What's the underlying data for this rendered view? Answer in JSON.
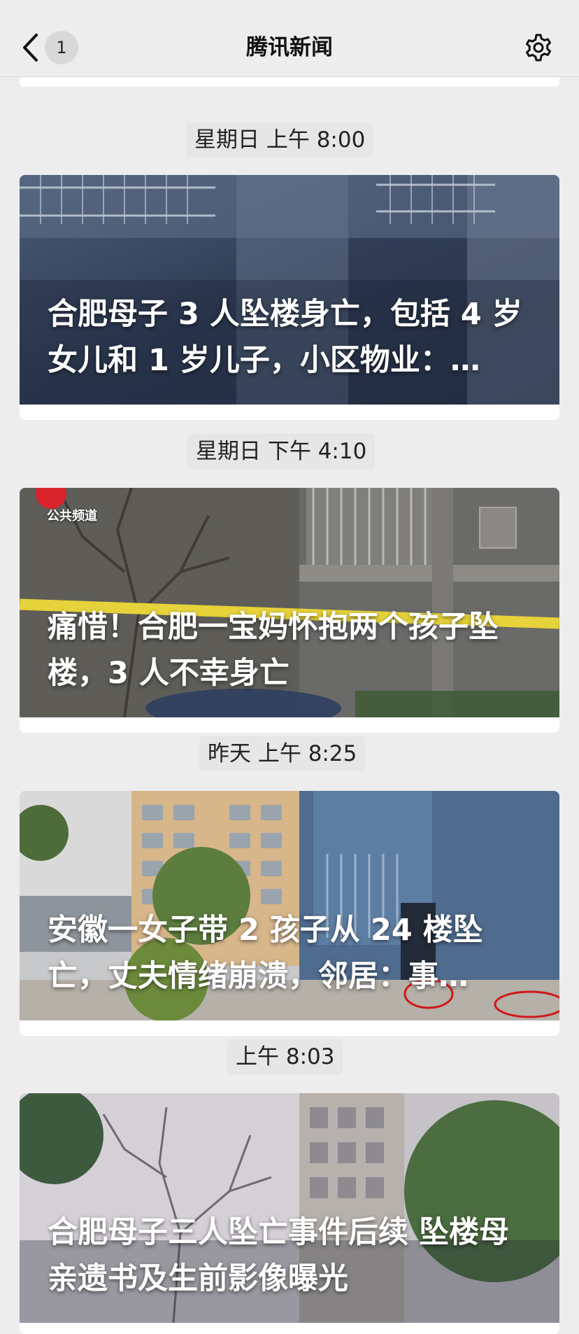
{
  "header": {
    "title": "腾讯新闻",
    "unread_count": "1",
    "back_icon": "chevron-left-icon",
    "settings_icon": "gear-icon"
  },
  "messages": [
    {
      "time": "星期日 上午 8:00",
      "title": "合肥母子 3 人坠楼身亡，包括 4 岁女儿和 1 岁儿子，小区物业：…"
    },
    {
      "time": "星期日 下午 4:10",
      "title": "痛惜！合肥一宝妈怀抱两个孩子坠楼，3 人不幸身亡",
      "logo_text": "公共频道"
    },
    {
      "time": "昨天 上午 8:25",
      "title": "安徽一女子带 2 孩子从 24 楼坠亡，丈夫情绪崩溃，邻居：事…"
    },
    {
      "time": "上午 8:03",
      "title": "合肥母子三人坠亡事件后续 坠楼母亲遗书及生前影像曝光"
    }
  ]
}
